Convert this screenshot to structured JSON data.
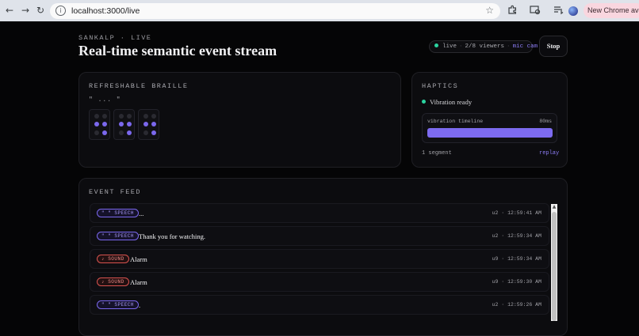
{
  "browser": {
    "url": "localhost:3000/live",
    "new_chrome": "New Chrome available",
    "back_glyph": "←",
    "forward_glyph": "→",
    "reload_glyph": "↻",
    "info_glyph": "i",
    "star_glyph": "☆",
    "icons": [
      "back-icon",
      "forward-icon",
      "reload-icon",
      "site-info-icon",
      "bookmark-star-icon",
      "extensions-icon",
      "media-icon",
      "reading-list-icon",
      "profile-avatar-icon"
    ]
  },
  "header": {
    "eyebrow": "SANKALP · LIVE",
    "title": "Real-time semantic event stream",
    "status": {
      "live": "live",
      "viewers": "2/8 viewers",
      "mic_cam": "mic cam"
    },
    "stop_label": "Stop"
  },
  "braille": {
    "title": "REFRESHABLE BRAILLE",
    "text": "\" ... \"",
    "cells": [
      [
        false,
        false,
        true,
        true,
        false,
        true
      ],
      [
        false,
        false,
        true,
        true,
        false,
        true
      ],
      [
        false,
        false,
        true,
        true,
        false,
        true
      ]
    ]
  },
  "haptics": {
    "title": "HAPTICS",
    "status": "Vibration ready",
    "timeline_label": "vibration timeline",
    "duration": "80ms",
    "fill_fraction": 1.0,
    "segments": "1 segment",
    "replay": "replay"
  },
  "feed": {
    "title": "EVENT FEED",
    "events": [
      {
        "type": "speech",
        "tag": "\" \" SPEECH",
        "text": "...",
        "meta": "u2 · 12:59:41 AM"
      },
      {
        "type": "speech",
        "tag": "\" \" SPEECH",
        "text": "Thank you for watching.",
        "meta": "u2 · 12:59:34 AM"
      },
      {
        "type": "sound",
        "tag": "♪ SOUND",
        "text": "Alarm",
        "meta": "u9 · 12:59:34 AM"
      },
      {
        "type": "sound",
        "tag": "♪ SOUND",
        "text": "Alarm",
        "meta": "u9 · 12:59:30 AM"
      },
      {
        "type": "speech",
        "tag": "\" \" SPEECH",
        "text": ".",
        "meta": "u2 · 12:59:26 AM"
      }
    ]
  },
  "colors": {
    "accent": "#7b68ee",
    "live_green": "#2bd4a0",
    "sound_red": "#d9534f",
    "background": "#050506"
  }
}
